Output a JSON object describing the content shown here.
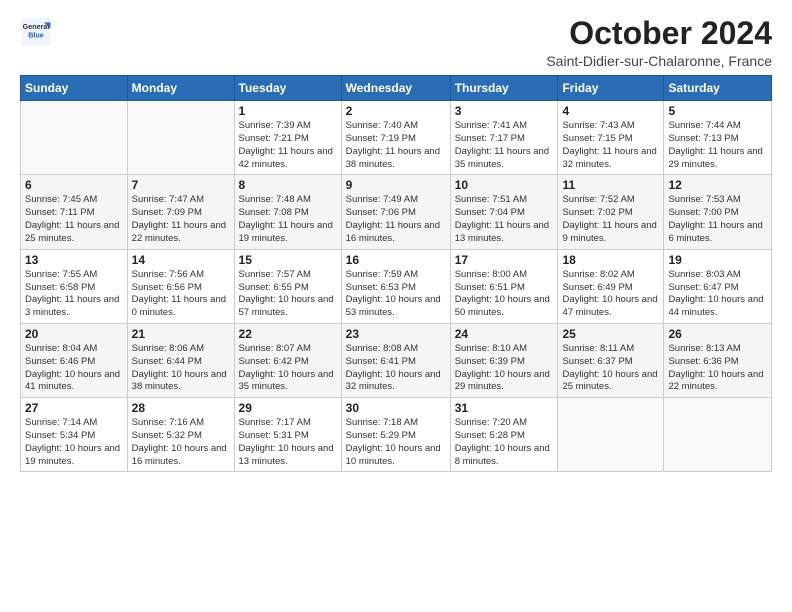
{
  "logo": {
    "general": "General",
    "blue": "Blue"
  },
  "header": {
    "month": "October 2024",
    "location": "Saint-Didier-sur-Chalaronne, France"
  },
  "weekdays": [
    "Sunday",
    "Monday",
    "Tuesday",
    "Wednesday",
    "Thursday",
    "Friday",
    "Saturday"
  ],
  "weeks": [
    [
      {
        "day": "",
        "sunrise": "",
        "sunset": "",
        "daylight": ""
      },
      {
        "day": "",
        "sunrise": "",
        "sunset": "",
        "daylight": ""
      },
      {
        "day": "1",
        "sunrise": "Sunrise: 7:39 AM",
        "sunset": "Sunset: 7:21 PM",
        "daylight": "Daylight: 11 hours and 42 minutes."
      },
      {
        "day": "2",
        "sunrise": "Sunrise: 7:40 AM",
        "sunset": "Sunset: 7:19 PM",
        "daylight": "Daylight: 11 hours and 38 minutes."
      },
      {
        "day": "3",
        "sunrise": "Sunrise: 7:41 AM",
        "sunset": "Sunset: 7:17 PM",
        "daylight": "Daylight: 11 hours and 35 minutes."
      },
      {
        "day": "4",
        "sunrise": "Sunrise: 7:43 AM",
        "sunset": "Sunset: 7:15 PM",
        "daylight": "Daylight: 11 hours and 32 minutes."
      },
      {
        "day": "5",
        "sunrise": "Sunrise: 7:44 AM",
        "sunset": "Sunset: 7:13 PM",
        "daylight": "Daylight: 11 hours and 29 minutes."
      }
    ],
    [
      {
        "day": "6",
        "sunrise": "Sunrise: 7:45 AM",
        "sunset": "Sunset: 7:11 PM",
        "daylight": "Daylight: 11 hours and 25 minutes."
      },
      {
        "day": "7",
        "sunrise": "Sunrise: 7:47 AM",
        "sunset": "Sunset: 7:09 PM",
        "daylight": "Daylight: 11 hours and 22 minutes."
      },
      {
        "day": "8",
        "sunrise": "Sunrise: 7:48 AM",
        "sunset": "Sunset: 7:08 PM",
        "daylight": "Daylight: 11 hours and 19 minutes."
      },
      {
        "day": "9",
        "sunrise": "Sunrise: 7:49 AM",
        "sunset": "Sunset: 7:06 PM",
        "daylight": "Daylight: 11 hours and 16 minutes."
      },
      {
        "day": "10",
        "sunrise": "Sunrise: 7:51 AM",
        "sunset": "Sunset: 7:04 PM",
        "daylight": "Daylight: 11 hours and 13 minutes."
      },
      {
        "day": "11",
        "sunrise": "Sunrise: 7:52 AM",
        "sunset": "Sunset: 7:02 PM",
        "daylight": "Daylight: 11 hours and 9 minutes."
      },
      {
        "day": "12",
        "sunrise": "Sunrise: 7:53 AM",
        "sunset": "Sunset: 7:00 PM",
        "daylight": "Daylight: 11 hours and 6 minutes."
      }
    ],
    [
      {
        "day": "13",
        "sunrise": "Sunrise: 7:55 AM",
        "sunset": "Sunset: 6:58 PM",
        "daylight": "Daylight: 11 hours and 3 minutes."
      },
      {
        "day": "14",
        "sunrise": "Sunrise: 7:56 AM",
        "sunset": "Sunset: 6:56 PM",
        "daylight": "Daylight: 11 hours and 0 minutes."
      },
      {
        "day": "15",
        "sunrise": "Sunrise: 7:57 AM",
        "sunset": "Sunset: 6:55 PM",
        "daylight": "Daylight: 10 hours and 57 minutes."
      },
      {
        "day": "16",
        "sunrise": "Sunrise: 7:59 AM",
        "sunset": "Sunset: 6:53 PM",
        "daylight": "Daylight: 10 hours and 53 minutes."
      },
      {
        "day": "17",
        "sunrise": "Sunrise: 8:00 AM",
        "sunset": "Sunset: 6:51 PM",
        "daylight": "Daylight: 10 hours and 50 minutes."
      },
      {
        "day": "18",
        "sunrise": "Sunrise: 8:02 AM",
        "sunset": "Sunset: 6:49 PM",
        "daylight": "Daylight: 10 hours and 47 minutes."
      },
      {
        "day": "19",
        "sunrise": "Sunrise: 8:03 AM",
        "sunset": "Sunset: 6:47 PM",
        "daylight": "Daylight: 10 hours and 44 minutes."
      }
    ],
    [
      {
        "day": "20",
        "sunrise": "Sunrise: 8:04 AM",
        "sunset": "Sunset: 6:46 PM",
        "daylight": "Daylight: 10 hours and 41 minutes."
      },
      {
        "day": "21",
        "sunrise": "Sunrise: 8:06 AM",
        "sunset": "Sunset: 6:44 PM",
        "daylight": "Daylight: 10 hours and 38 minutes."
      },
      {
        "day": "22",
        "sunrise": "Sunrise: 8:07 AM",
        "sunset": "Sunset: 6:42 PM",
        "daylight": "Daylight: 10 hours and 35 minutes."
      },
      {
        "day": "23",
        "sunrise": "Sunrise: 8:08 AM",
        "sunset": "Sunset: 6:41 PM",
        "daylight": "Daylight: 10 hours and 32 minutes."
      },
      {
        "day": "24",
        "sunrise": "Sunrise: 8:10 AM",
        "sunset": "Sunset: 6:39 PM",
        "daylight": "Daylight: 10 hours and 29 minutes."
      },
      {
        "day": "25",
        "sunrise": "Sunrise: 8:11 AM",
        "sunset": "Sunset: 6:37 PM",
        "daylight": "Daylight: 10 hours and 25 minutes."
      },
      {
        "day": "26",
        "sunrise": "Sunrise: 8:13 AM",
        "sunset": "Sunset: 6:36 PM",
        "daylight": "Daylight: 10 hours and 22 minutes."
      }
    ],
    [
      {
        "day": "27",
        "sunrise": "Sunrise: 7:14 AM",
        "sunset": "Sunset: 5:34 PM",
        "daylight": "Daylight: 10 hours and 19 minutes."
      },
      {
        "day": "28",
        "sunrise": "Sunrise: 7:16 AM",
        "sunset": "Sunset: 5:32 PM",
        "daylight": "Daylight: 10 hours and 16 minutes."
      },
      {
        "day": "29",
        "sunrise": "Sunrise: 7:17 AM",
        "sunset": "Sunset: 5:31 PM",
        "daylight": "Daylight: 10 hours and 13 minutes."
      },
      {
        "day": "30",
        "sunrise": "Sunrise: 7:18 AM",
        "sunset": "Sunset: 5:29 PM",
        "daylight": "Daylight: 10 hours and 10 minutes."
      },
      {
        "day": "31",
        "sunrise": "Sunrise: 7:20 AM",
        "sunset": "Sunset: 5:28 PM",
        "daylight": "Daylight: 10 hours and 8 minutes."
      },
      {
        "day": "",
        "sunrise": "",
        "sunset": "",
        "daylight": ""
      },
      {
        "day": "",
        "sunrise": "",
        "sunset": "",
        "daylight": ""
      }
    ]
  ]
}
